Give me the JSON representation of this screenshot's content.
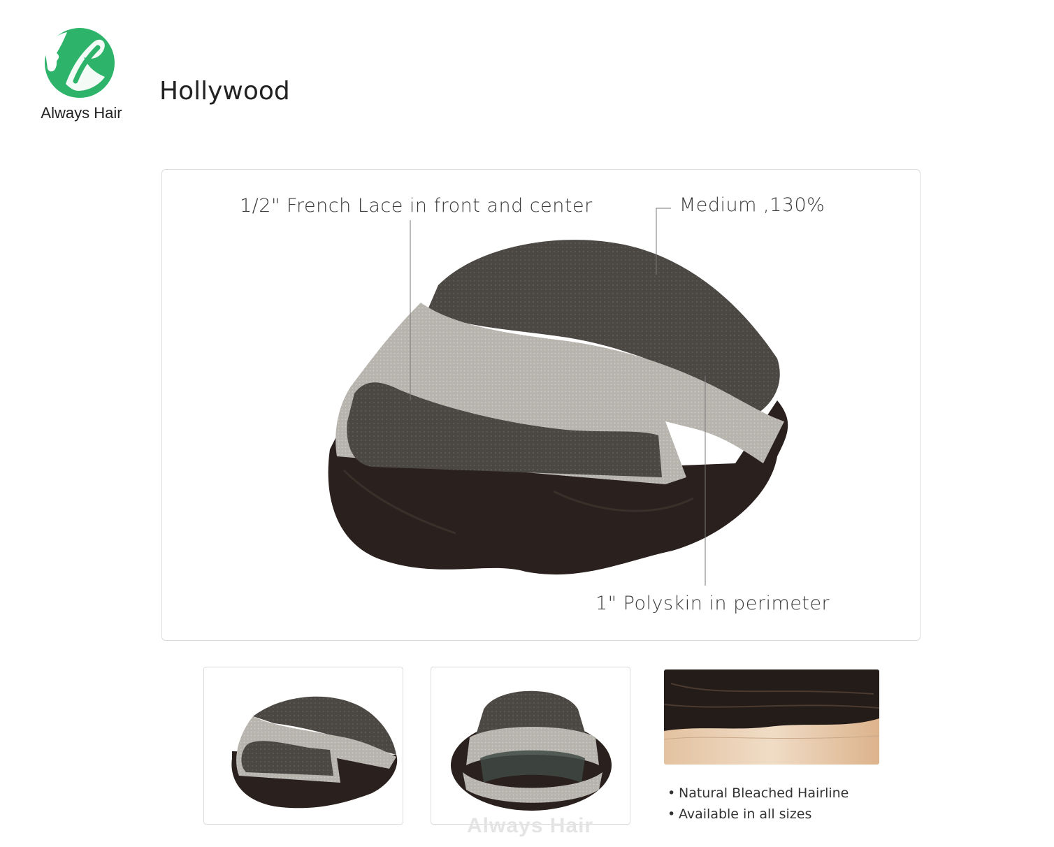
{
  "brand": {
    "name": "Always Hair",
    "logo_icon": "green-head-silhouette-logo"
  },
  "product": {
    "title": "Hollywood"
  },
  "callouts": {
    "front": "1/2\" French Lace in front and center",
    "density": "Medium ,130%",
    "perimeter": "1\" Polyskin in perimeter"
  },
  "features": [
    {
      "bullet": "•",
      "text": "Natural Bleached Hairline"
    },
    {
      "bullet": "•",
      "text": "Available in all sizes"
    }
  ],
  "watermark": "Always Hair",
  "colors": {
    "brand_green": "#2db46a",
    "lace": "#4a4743",
    "polyskin": "#b9b6b1",
    "hair": "#2a201d"
  }
}
